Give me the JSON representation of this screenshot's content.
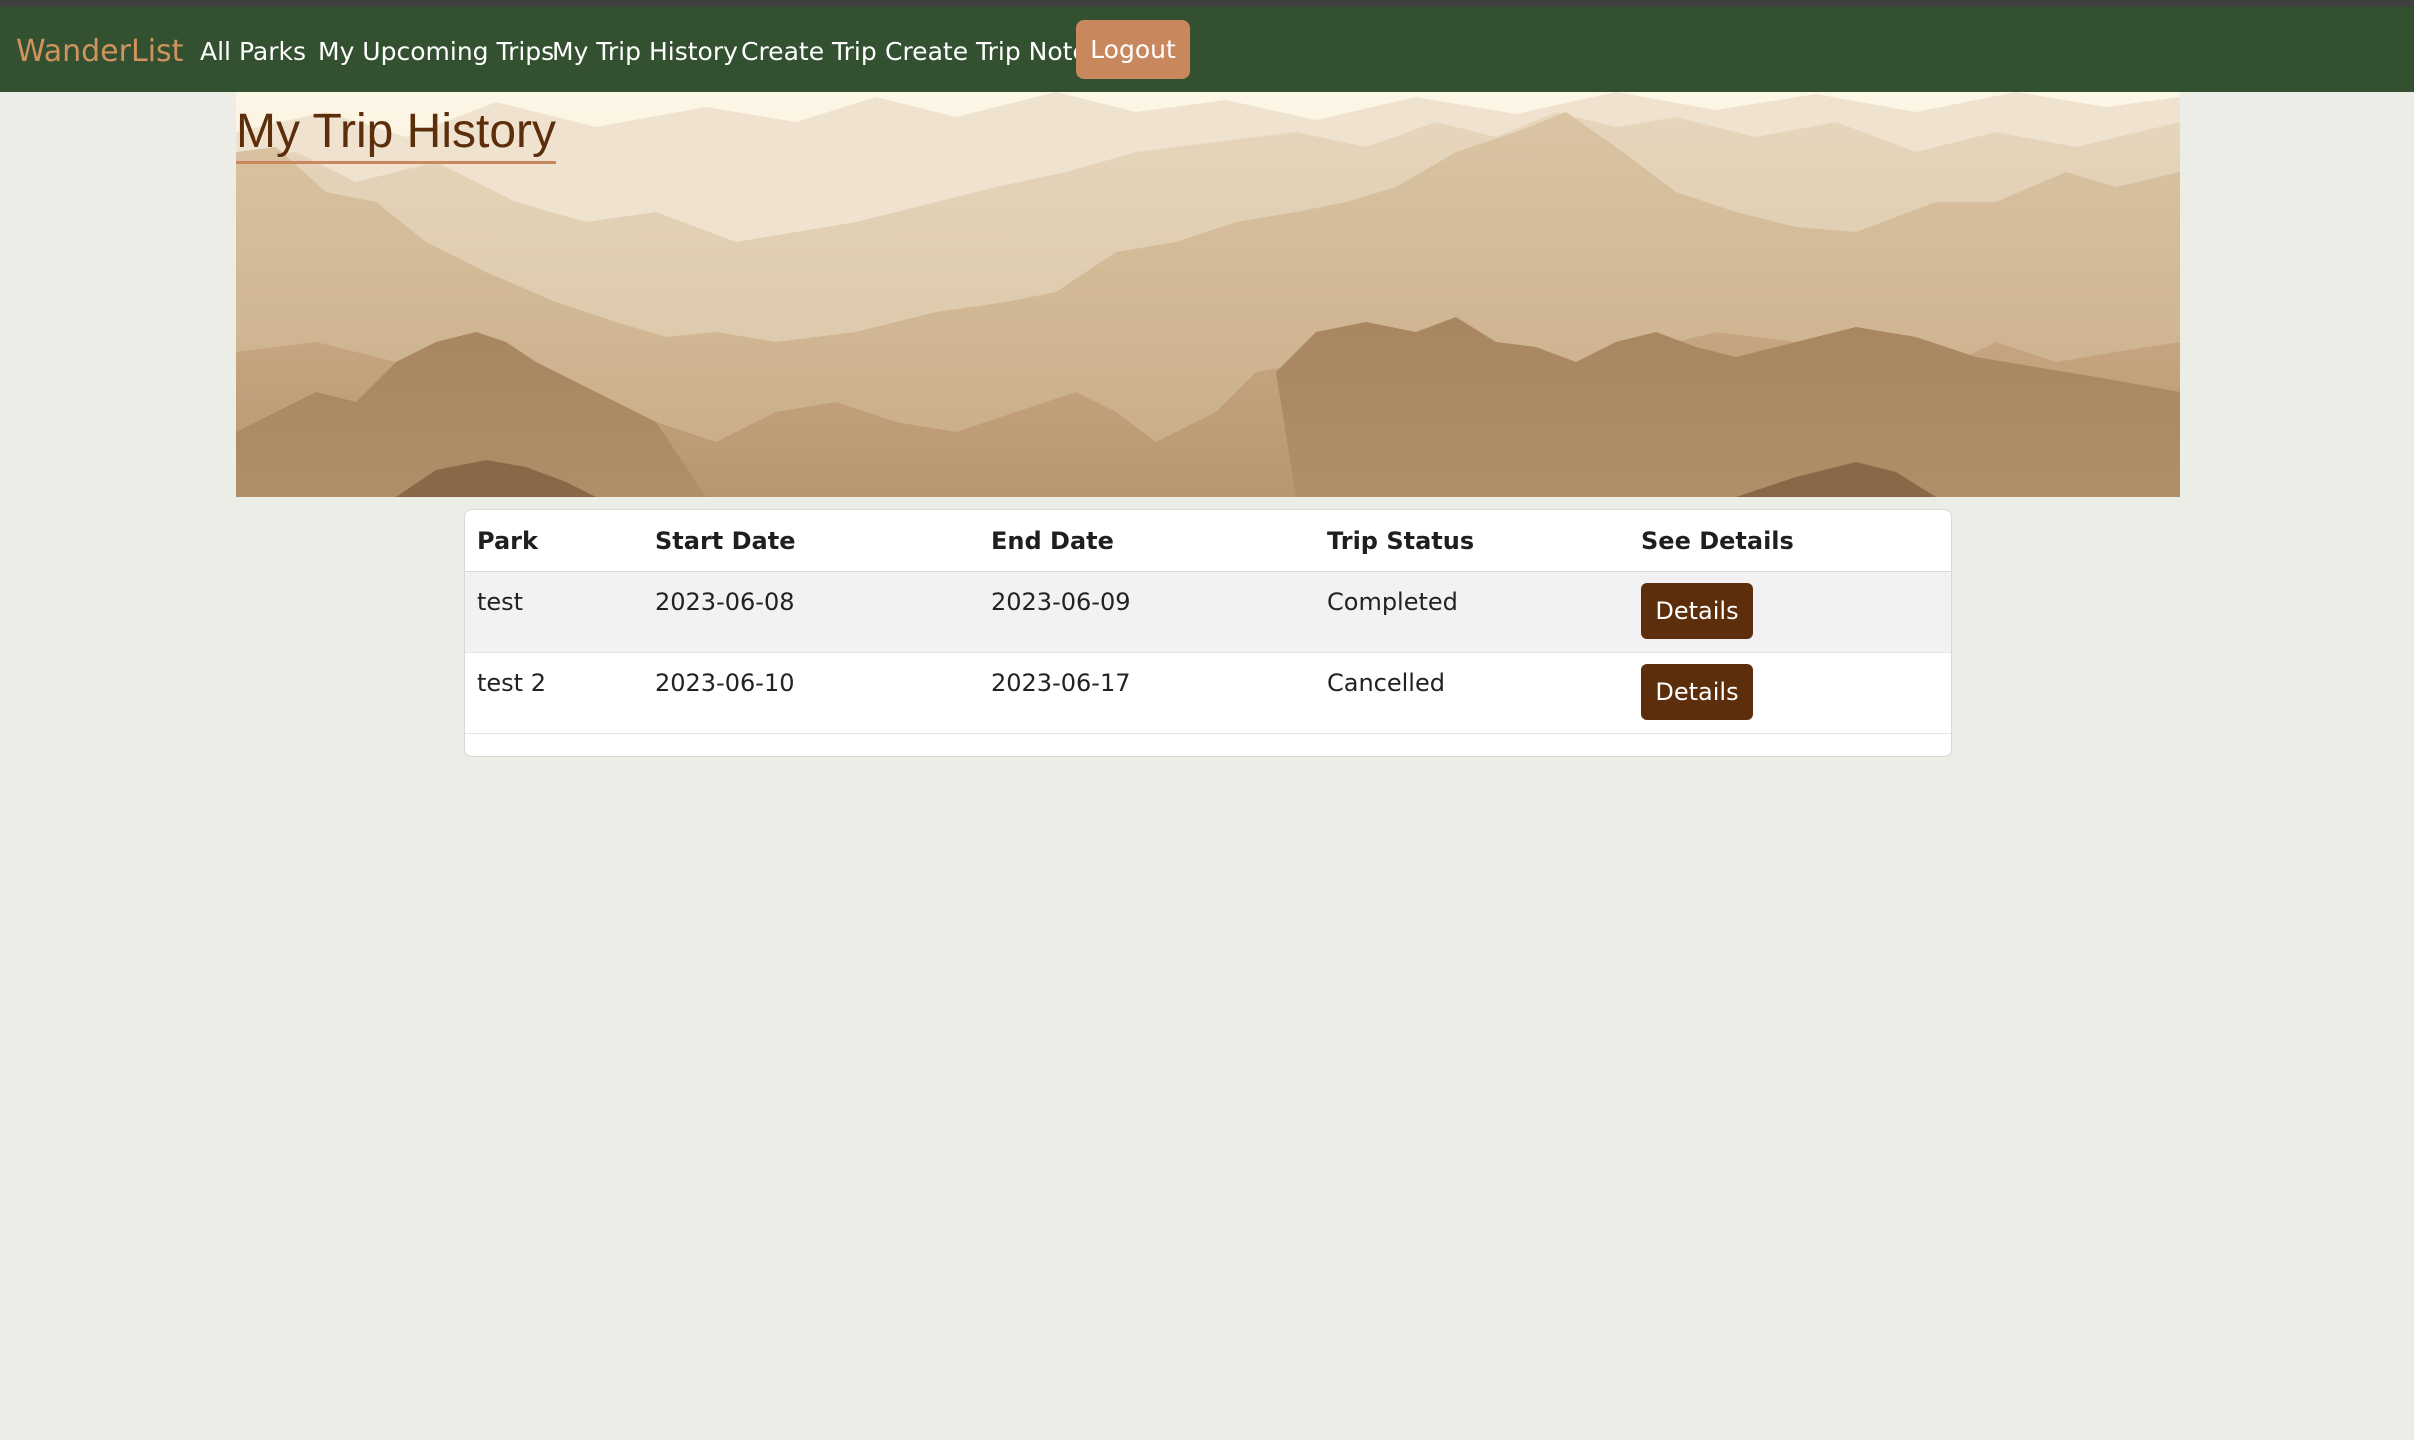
{
  "navbar": {
    "brand": "WanderList",
    "links": [
      "All Parks",
      "My Upcoming Trips",
      "My Trip History",
      "Create Trip",
      "Create Trip Note"
    ],
    "logout": "Logout"
  },
  "page": {
    "title": "My Trip History"
  },
  "table": {
    "headers": [
      "Park",
      "Start Date",
      "End Date",
      "Trip Status",
      "See Details"
    ],
    "rows": [
      {
        "park": "test",
        "start": "2023-06-08",
        "end": "2023-06-09",
        "status": "Completed",
        "action": "Details"
      },
      {
        "park": "test 2",
        "start": "2023-06-10",
        "end": "2023-06-17",
        "status": "Cancelled",
        "action": "Details"
      }
    ]
  },
  "colors": {
    "navbar": "#335130",
    "brand": "#d0935e",
    "logout": "#c9875d",
    "button": "#5c2e0c",
    "title": "#5c2e0c",
    "background": "#ecede7"
  }
}
